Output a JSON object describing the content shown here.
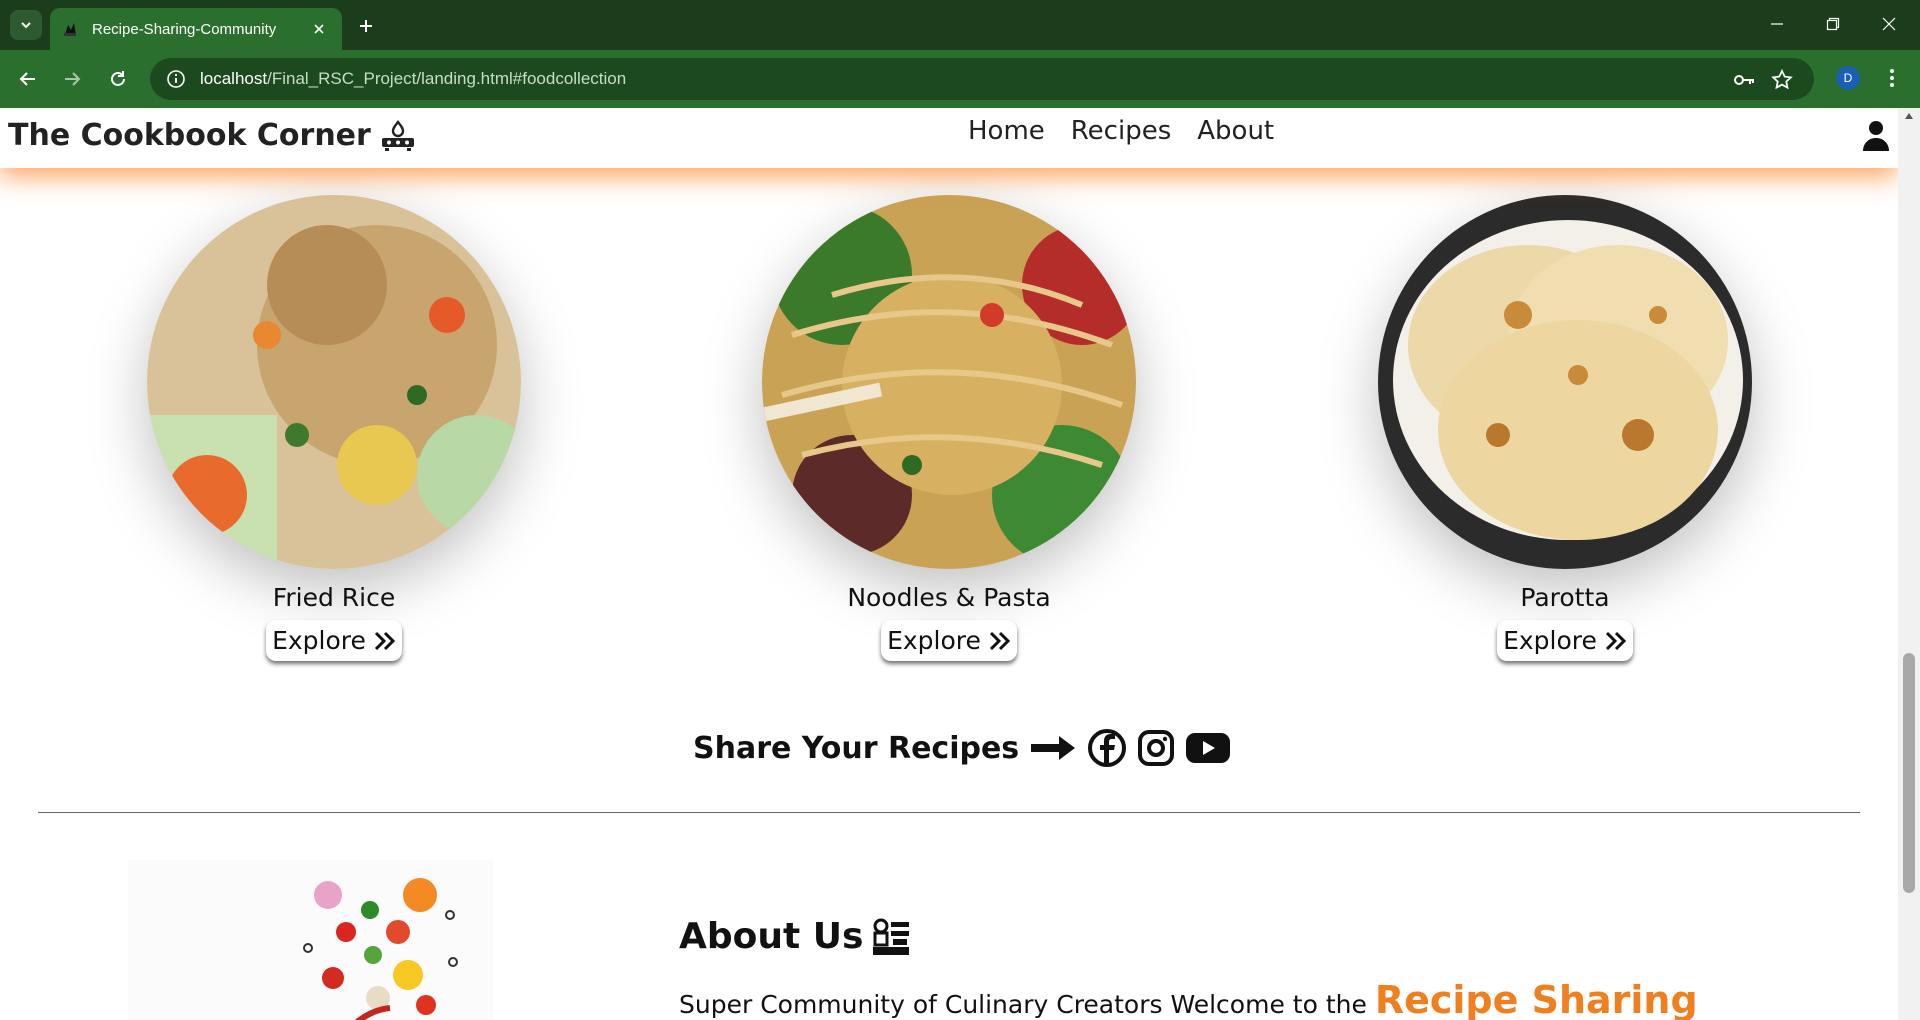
{
  "browser": {
    "tab_title": "Recipe-Sharing-Community",
    "url_host": "localhost",
    "url_path": "/Final_RSC_Project/landing.html#foodcollection",
    "profile_initial": "D"
  },
  "header": {
    "brand": "The Cookbook Corner",
    "nav": [
      "Home",
      "Recipes",
      "About"
    ]
  },
  "foods": [
    {
      "name": "Fried Rice",
      "button": "Explore"
    },
    {
      "name": "Noodles & Pasta",
      "button": "Explore"
    },
    {
      "name": "Parotta",
      "button": "Explore"
    }
  ],
  "share": {
    "label": "Share Your Recipes"
  },
  "about": {
    "title": "About Us",
    "text": "Super Community of Culinary Creators Welcome to the",
    "accent": "Recipe Sharing"
  },
  "colors": {
    "accent": "#f07f20",
    "chrome": "#2b6f2f"
  }
}
